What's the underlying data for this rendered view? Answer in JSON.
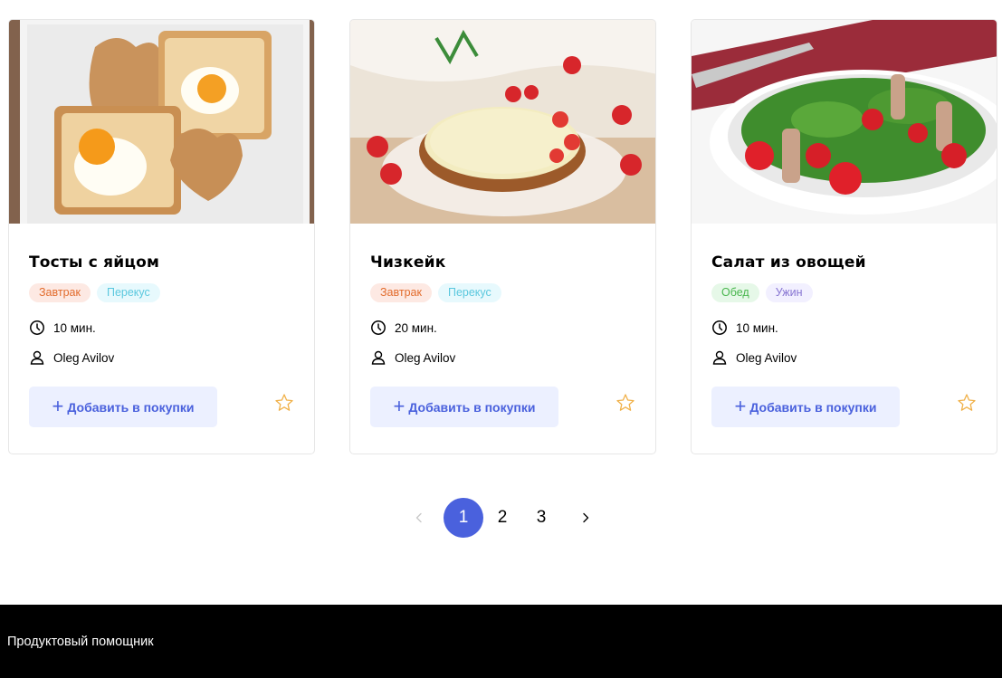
{
  "recipes": [
    {
      "title": "Тосты с яйцом",
      "tags": [
        {
          "label": "Завтрак",
          "bg": "#fde9e3",
          "color": "#e26c2d"
        },
        {
          "label": "Перекус",
          "bg": "#e7f9fd",
          "color": "#5bc8de"
        }
      ],
      "time": "10 мин.",
      "author": "Oleg Avilov",
      "add_label": "Добавить в покупки",
      "image": "toast-with-egg-photo"
    },
    {
      "title": "Чизкейк",
      "tags": [
        {
          "label": "Завтрак",
          "bg": "#fde9e3",
          "color": "#e26c2d"
        },
        {
          "label": "Перекус",
          "bg": "#e7f9fd",
          "color": "#5bc8de"
        }
      ],
      "time": "20 мин.",
      "author": "Oleg Avilov",
      "add_label": "Добавить в покупки",
      "image": "cheesecake-photo"
    },
    {
      "title": "Салат из овощей",
      "tags": [
        {
          "label": "Обед",
          "bg": "#e6f8e8",
          "color": "#49b64e"
        },
        {
          "label": "Ужин",
          "bg": "#f2f0ff",
          "color": "#8775d2"
        }
      ],
      "time": "10 мин.",
      "author": "Oleg Avilov",
      "add_label": "Добавить в покупки",
      "image": "vegetable-salad-photo"
    }
  ],
  "pagination": {
    "pages": [
      "1",
      "2",
      "3"
    ],
    "current": "1",
    "prev_icon": "chevron-left-icon",
    "next_icon": "chevron-right-icon"
  },
  "footer": {
    "brand": "Продуктовый помощник"
  },
  "colors": {
    "accent": "#4a61dd",
    "button_bg": "#ecf0ff",
    "star": "#f0b14a",
    "footer_bg": "#000000"
  }
}
